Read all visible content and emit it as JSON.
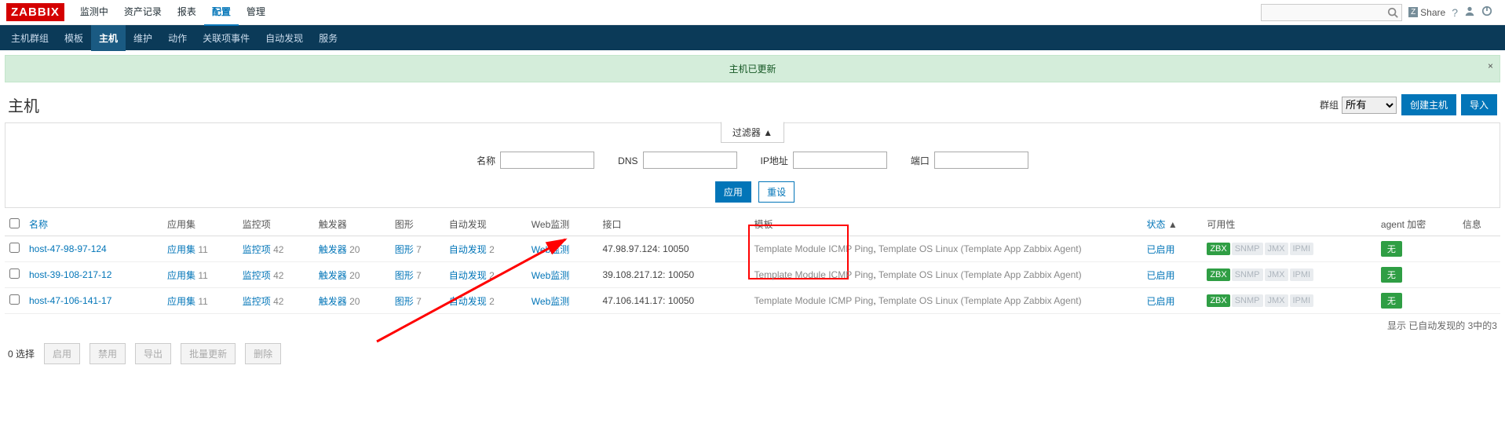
{
  "logo": "ZABBIX",
  "topnav": [
    "监测中",
    "资产记录",
    "报表",
    "配置",
    "管理"
  ],
  "topnav_active": 3,
  "share": "Share",
  "subnav": [
    "主机群组",
    "模板",
    "主机",
    "维护",
    "动作",
    "关联项事件",
    "自动发现",
    "服务"
  ],
  "subnav_active": 2,
  "msg": "主机已更新",
  "title": "主机",
  "group_label": "群组",
  "group_value": "所有",
  "btn_create": "创建主机",
  "btn_import": "导入",
  "filter_tab": "过滤器 ▲",
  "filters": {
    "name_lbl": "名称",
    "dns_lbl": "DNS",
    "ip_lbl": "IP地址",
    "port_lbl": "端口",
    "apply": "应用",
    "reset": "重设"
  },
  "cols": {
    "name": "名称",
    "apps": "应用集",
    "items": "监控项",
    "triggers": "触发器",
    "graphs": "图形",
    "discovery": "自动发现",
    "web": "Web监测",
    "iface": "接口",
    "tmpl": "模板",
    "status": "状态",
    "avail": "可用性",
    "enc": "agent 加密",
    "info": "信息"
  },
  "rows": [
    {
      "name": "host-47-98-97-124",
      "apps": "11",
      "items": "42",
      "triggers": "20",
      "graphs": "7",
      "disc": "2",
      "iface": "47.98.97.124: 10050",
      "tmpl1": "Template Module ICMP Ping",
      "tmpl2": "Template OS Linux (Template App Zabbix Agent)",
      "status": "已启用",
      "enc": "无"
    },
    {
      "name": "host-39-108-217-12",
      "apps": "11",
      "items": "42",
      "triggers": "20",
      "graphs": "7",
      "disc": "2",
      "iface": "39.108.217.12: 10050",
      "tmpl1": "Template Module ICMP Ping",
      "tmpl2": "Template OS Linux (Template App Zabbix Agent)",
      "status": "已启用",
      "enc": "无"
    },
    {
      "name": "host-47-106-141-17",
      "apps": "11",
      "items": "42",
      "triggers": "20",
      "graphs": "7",
      "disc": "2",
      "iface": "47.106.141.17: 10050",
      "tmpl1": "Template Module ICMP Ping",
      "tmpl2": "Template OS Linux (Template App Zabbix Agent)",
      "status": "已启用",
      "enc": "无"
    }
  ],
  "labels": {
    "apps": "应用集",
    "items": "监控项",
    "triggers": "触发器",
    "graphs": "图形",
    "disc": "自动发现",
    "web": "Web监测"
  },
  "avail_tags": [
    "ZBX",
    "SNMP",
    "JMX",
    "IPMI"
  ],
  "footer": "显示 已自动发现的 3中的3",
  "bulk": {
    "sel": "0 选择",
    "enable": "启用",
    "disable": "禁用",
    "export": "导出",
    "massupdate": "批量更新",
    "delete": "删除"
  }
}
